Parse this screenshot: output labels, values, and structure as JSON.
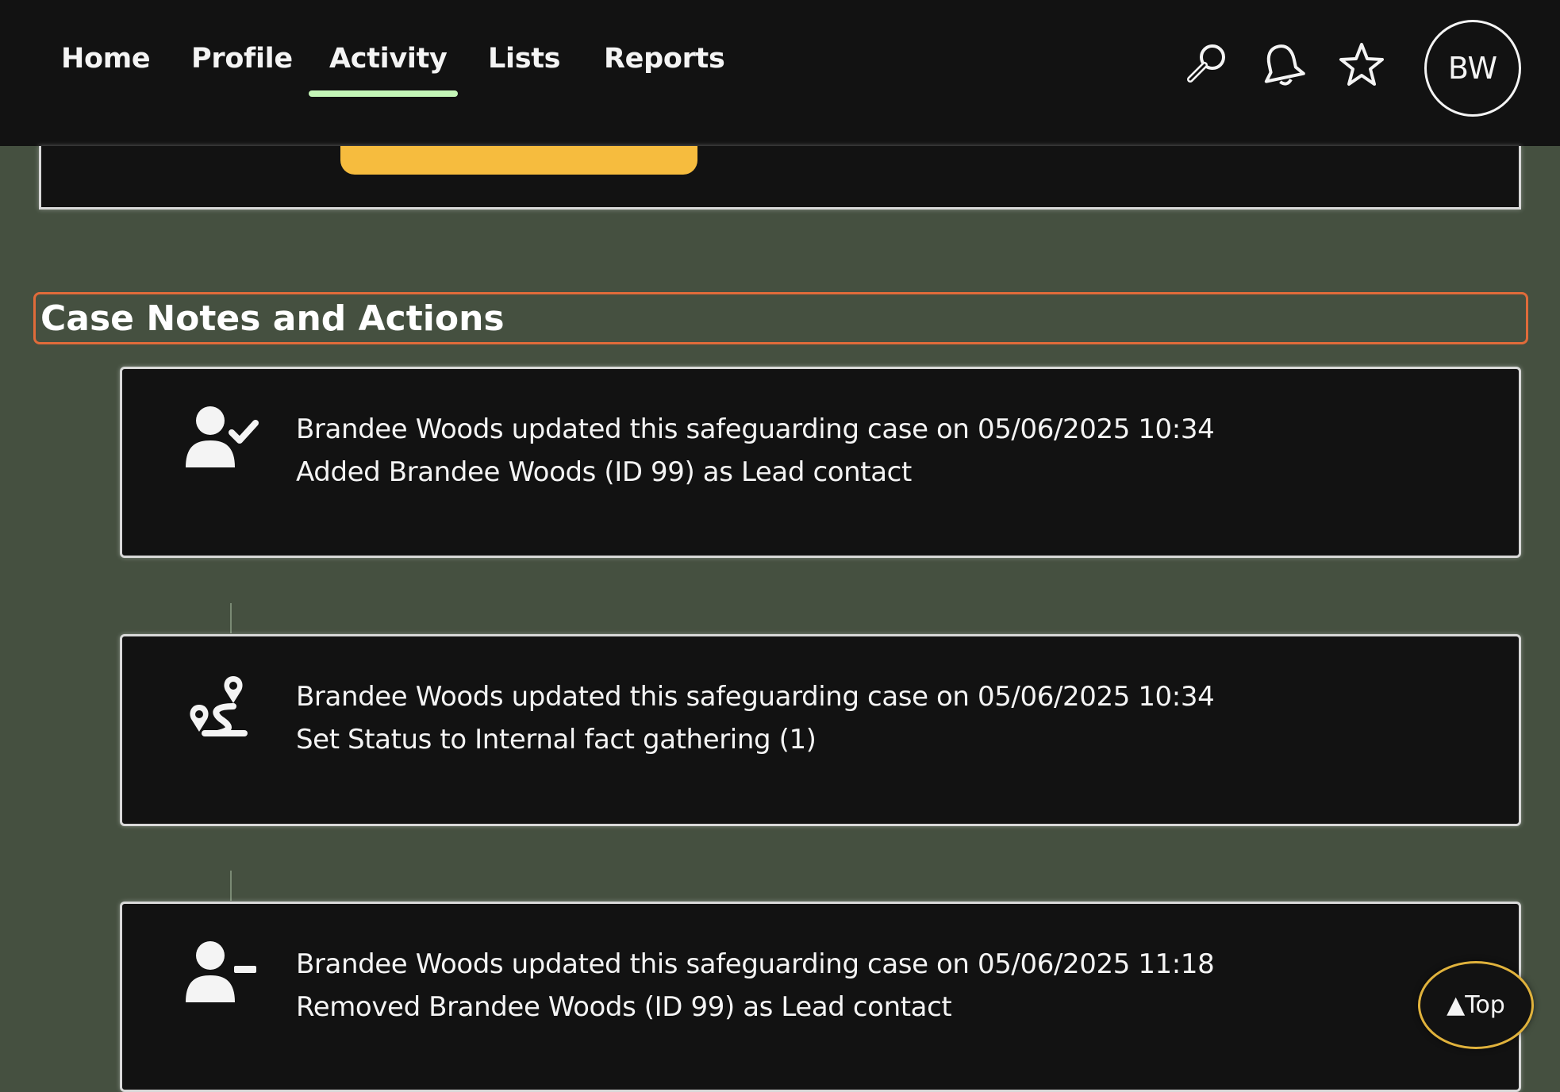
{
  "nav": {
    "tabs": [
      {
        "label": "Home"
      },
      {
        "label": "Profile"
      },
      {
        "label": "Activity",
        "active": true
      },
      {
        "label": "Lists"
      },
      {
        "label": "Reports"
      }
    ],
    "icons": [
      "search-icon",
      "bell-icon",
      "star-icon"
    ],
    "avatar_initials": "BW",
    "active_underline_color": "#c4f5b7"
  },
  "section": {
    "heading": "Case Notes and Actions",
    "heading_border_color": "#e06b3a"
  },
  "entries": [
    {
      "icon": "user-check-icon",
      "line1": "Brandee Woods updated this safeguarding case on 05/06/2025 10:34",
      "line2": "Added Brandee Woods (ID 99) as Lead contact"
    },
    {
      "icon": "route-icon",
      "line1": "Brandee Woods updated this safeguarding case on 05/06/2025 10:34",
      "line2": "Set Status to Internal fact gathering (1)"
    },
    {
      "icon": "user-minus-icon",
      "line1": "Brandee Woods updated this safeguarding case on 05/06/2025 11:18",
      "line2": "Removed Brandee Woods (ID 99) as Lead contact"
    }
  ],
  "top_button": {
    "label": "▲Top"
  },
  "colors": {
    "page_bg": "#455040",
    "bar_bg": "#121212",
    "card_bg": "#121212",
    "accent_yellow": "#f6bc3e"
  }
}
